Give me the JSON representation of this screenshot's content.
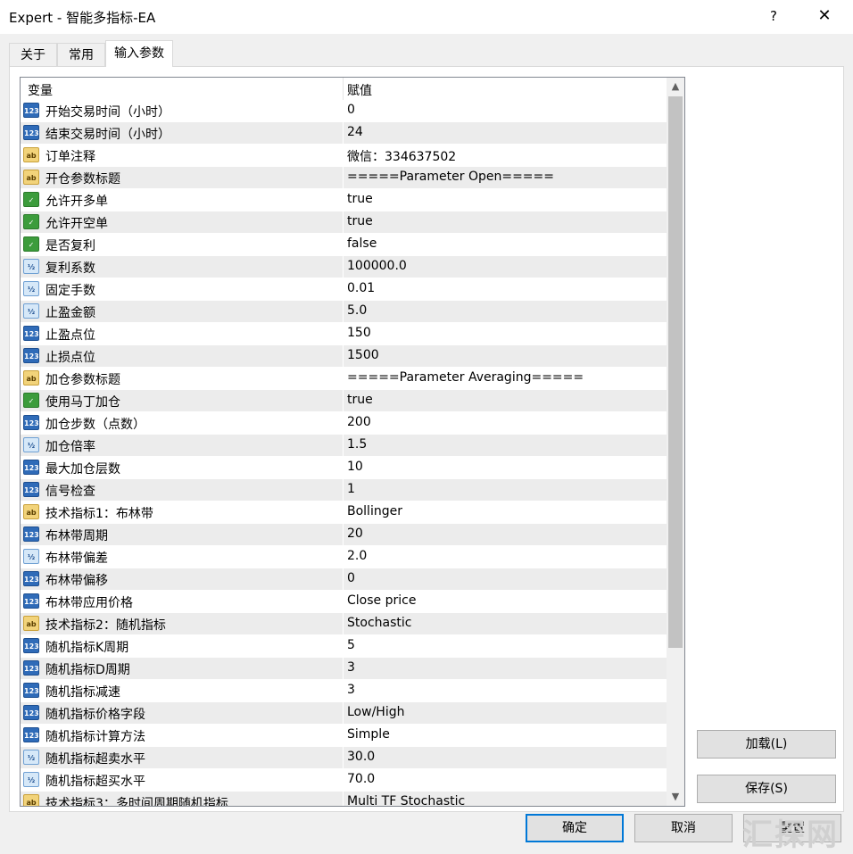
{
  "window": {
    "title": "Expert - 智能多指标-EA",
    "help_label": "?",
    "close_label": "✕"
  },
  "tabs": [
    {
      "label": "关于"
    },
    {
      "label": "常用"
    },
    {
      "label": "输入参数"
    }
  ],
  "active_tab": "输入参数",
  "table": {
    "header": {
      "variable": "变量",
      "value": "赋值"
    },
    "rows": [
      {
        "icon": "int-icon",
        "icon_text": "123",
        "name": "开始交易时间（小时）",
        "value": "0"
      },
      {
        "icon": "int-icon",
        "icon_text": "123",
        "name": "结束交易时间（小时）",
        "value": "24"
      },
      {
        "icon": "string-icon",
        "icon_text": "ab",
        "name": "订单注释",
        "value": "微信：334637502"
      },
      {
        "icon": "string-icon",
        "icon_text": "ab",
        "name": "开仓参数标题",
        "value": "=====Parameter Open====="
      },
      {
        "icon": "bool-icon",
        "icon_text": "✓",
        "name": "允许开多单",
        "value": "true"
      },
      {
        "icon": "bool-icon",
        "icon_text": "✓",
        "name": "允许开空单",
        "value": "true"
      },
      {
        "icon": "bool-icon",
        "icon_text": "✓",
        "name": "是否复利",
        "value": "false"
      },
      {
        "icon": "double-icon",
        "icon_text": "½",
        "name": "复利系数",
        "value": "100000.0"
      },
      {
        "icon": "double-icon",
        "icon_text": "½",
        "name": "固定手数",
        "value": "0.01"
      },
      {
        "icon": "double-icon",
        "icon_text": "½",
        "name": "止盈金额",
        "value": "5.0"
      },
      {
        "icon": "int-icon",
        "icon_text": "123",
        "name": "止盈点位",
        "value": "150"
      },
      {
        "icon": "int-icon",
        "icon_text": "123",
        "name": "止损点位",
        "value": "1500"
      },
      {
        "icon": "string-icon",
        "icon_text": "ab",
        "name": "加仓参数标题",
        "value": "=====Parameter Averaging====="
      },
      {
        "icon": "bool-icon",
        "icon_text": "✓",
        "name": "使用马丁加仓",
        "value": "true"
      },
      {
        "icon": "int-icon",
        "icon_text": "123",
        "name": "加仓步数（点数）",
        "value": "200"
      },
      {
        "icon": "double-icon",
        "icon_text": "½",
        "name": "加仓倍率",
        "value": "1.5"
      },
      {
        "icon": "int-icon",
        "icon_text": "123",
        "name": "最大加仓层数",
        "value": "10"
      },
      {
        "icon": "int-icon",
        "icon_text": "123",
        "name": "信号检查",
        "value": "1"
      },
      {
        "icon": "string-icon",
        "icon_text": "ab",
        "name": "技术指标1：布林带",
        "value": "Bollinger"
      },
      {
        "icon": "int-icon",
        "icon_text": "123",
        "name": "布林带周期",
        "value": "20"
      },
      {
        "icon": "double-icon",
        "icon_text": "½",
        "name": "布林带偏差",
        "value": "2.0"
      },
      {
        "icon": "int-icon",
        "icon_text": "123",
        "name": "布林带偏移",
        "value": "0"
      },
      {
        "icon": "int-icon",
        "icon_text": "123",
        "name": "布林带应用价格",
        "value": "Close price"
      },
      {
        "icon": "string-icon",
        "icon_text": "ab",
        "name": "技术指标2：随机指标",
        "value": "Stochastic"
      },
      {
        "icon": "int-icon",
        "icon_text": "123",
        "name": "随机指标K周期",
        "value": "5"
      },
      {
        "icon": "int-icon",
        "icon_text": "123",
        "name": "随机指标D周期",
        "value": "3"
      },
      {
        "icon": "int-icon",
        "icon_text": "123",
        "name": "随机指标减速",
        "value": "3"
      },
      {
        "icon": "int-icon",
        "icon_text": "123",
        "name": "随机指标价格字段",
        "value": "Low/High"
      },
      {
        "icon": "int-icon",
        "icon_text": "123",
        "name": "随机指标计算方法",
        "value": "Simple"
      },
      {
        "icon": "double-icon",
        "icon_text": "½",
        "name": "随机指标超卖水平",
        "value": "30.0"
      },
      {
        "icon": "double-icon",
        "icon_text": "½",
        "name": "随机指标超买水平",
        "value": "70.0"
      },
      {
        "icon": "string-icon",
        "icon_text": "ab",
        "name": "技术指标3：多时间周期随机指标",
        "value": "Multi TF Stochastic"
      }
    ]
  },
  "scrollbar": {
    "up_icon": "▲",
    "down_icon": "▼"
  },
  "buttons": {
    "load": "加载(L)",
    "save": "保存(S)",
    "ok": "确定",
    "cancel": "取消",
    "reset": "重置"
  },
  "watermark": "汇探网"
}
